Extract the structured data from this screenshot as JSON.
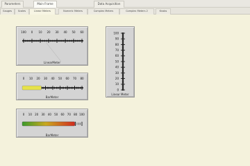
{
  "window": {
    "top_tabs": [
      {
        "label": "Parameters"
      },
      {
        "label": "Main Frame"
      },
      {
        "label": "Data Acquisition"
      }
    ],
    "sub_tabs": [
      {
        "label": "Gauges"
      },
      {
        "label": "Scales"
      },
      {
        "label": "Linear Meters"
      },
      {
        "label": "Numeric Meters"
      },
      {
        "label": "Complex Meters"
      },
      {
        "label": "Complex Meters 2"
      },
      {
        "label": "Knobs"
      }
    ]
  },
  "meters": {
    "top_left": {
      "label": "LinearMeter",
      "scale": [
        "100",
        "0",
        "10",
        "20",
        "30",
        "40",
        "50",
        "60"
      ]
    },
    "middle_left": {
      "label": "BarMeter",
      "scale": [
        "0",
        "10",
        "20",
        "30",
        "40",
        "50",
        "60",
        "70",
        "80"
      ],
      "fill_fraction": 0.32
    },
    "bottom_left": {
      "label": "BarMeter",
      "scale": [
        "0",
        "10",
        "20",
        "30",
        "40",
        "50",
        "60",
        "70",
        "80",
        "100"
      ],
      "fill_fraction": 0.88
    },
    "right_vertical": {
      "label": "Linear Meter",
      "scale": [
        "100",
        "90",
        "80",
        "70",
        "60",
        "50",
        "40",
        "30",
        "20",
        "10",
        "0"
      ]
    }
  },
  "colors": {
    "fill_yellow": "#e6e24a",
    "fill_green": "#3a9a2a",
    "fill_red": "#d22b1f"
  }
}
